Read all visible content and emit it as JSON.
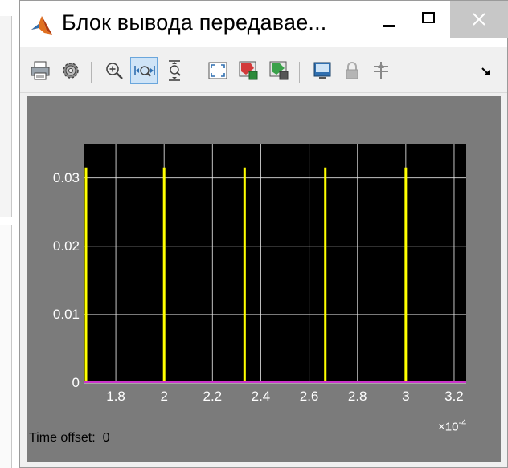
{
  "window": {
    "title": "Блок вывода передавае...",
    "app_icon": "matlab-logo-icon"
  },
  "toolbar": {
    "items": [
      {
        "name": "print-icon"
      },
      {
        "name": "settings-gear-icon"
      },
      {
        "name": "zoom-in-icon"
      },
      {
        "name": "zoom-x-icon",
        "active": true
      },
      {
        "name": "zoom-y-icon"
      },
      {
        "name": "autoscale-icon"
      },
      {
        "name": "trigger-icon"
      },
      {
        "name": "signal-select-icon"
      },
      {
        "name": "display-icon"
      },
      {
        "name": "lock-icon"
      },
      {
        "name": "signal-highlight-icon"
      },
      {
        "name": "dock-arrow-icon"
      }
    ]
  },
  "scope": {
    "time_offset_label": "Time offset:",
    "time_offset_value": "0",
    "x_exponent_base": "×10",
    "x_exponent_power": "-4"
  },
  "colors": {
    "axes_bg": "#000000",
    "figure_bg": "#7b7b7b",
    "signal": "#ffff00",
    "baseline": "#cc33cc",
    "grid": "#e6e6e6"
  },
  "chart_data": {
    "type": "line",
    "xlim": [
      1.67,
      3.25
    ],
    "ylim": [
      0,
      0.035
    ],
    "x_scale_exponent": -4,
    "xticks": [
      1.8,
      2,
      2.2,
      2.4,
      2.6,
      2.8,
      3,
      3.2
    ],
    "xtick_labels": [
      "1.8",
      "2",
      "2.2",
      "2.4",
      "2.6",
      "2.8",
      "3",
      "3.2"
    ],
    "yticks": [
      0,
      0.01,
      0.02,
      0.03
    ],
    "ytick_labels": [
      "0",
      "0.01",
      "0.02",
      "0.03"
    ],
    "grid": true,
    "series": [
      {
        "pulses": [
          {
            "x": 1.667,
            "y": 0.0315
          },
          {
            "x": 2.0,
            "y": 0.0315
          },
          {
            "x": 2.333,
            "y": 0.0315
          },
          {
            "x": 2.667,
            "y": 0.0315
          },
          {
            "x": 3.0,
            "y": 0.0315
          }
        ],
        "baseline": 0
      }
    ],
    "title": "",
    "xlabel": "",
    "ylabel": ""
  }
}
